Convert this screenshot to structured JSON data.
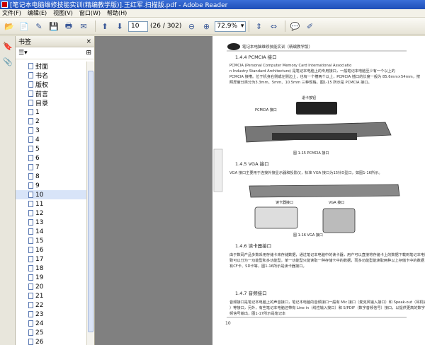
{
  "window": {
    "title": "[笔记本电脑维修技能实训(精编教学版)].王红军.扫描版.pdf - Adobe Reader"
  },
  "menu": {
    "items": [
      "文件(F)",
      "编辑(E)",
      "视图(V)",
      "窗口(W)",
      "帮助(H)"
    ]
  },
  "toolbar": {
    "page_value": "10",
    "page_total": "(26 / 302)",
    "zoom_value": "72.9%"
  },
  "bookmarks": {
    "title": "书签",
    "items": [
      "封面",
      "书名",
      "版权",
      "前言",
      "目录",
      "1",
      "2",
      "3",
      "4",
      "5",
      "6",
      "7",
      "8",
      "9",
      "10",
      "11",
      "12",
      "13",
      "14",
      "15",
      "16",
      "17",
      "18",
      "19",
      "20",
      "21",
      "22",
      "23",
      "24",
      "25",
      "26",
      "27"
    ],
    "selected_index": 14
  },
  "document": {
    "header": "笔记本电脑维修技能实训（精编教学版）",
    "section1_title": "1.4.4  PCMCIA 接口",
    "section1_body": "PCMCIA (Personal Computer Memory Card International Association Industry Standard Architecture) 是笔记本电脑上的专用接口，一般笔记本电脑至少有一个以上的 PCMCIA 接槽。位于机身右侧或左侧边上，也有一个槽两个以上，PCMCIA 插口的长度一般为 85.6mm×54mm，按照厚度分类分为3.3mm、5mm、10.5mm 三种规格。图1-15 所示是 PCMCIA 接口。",
    "fig1_label_top": "退卡按钮",
    "fig1_label_left": "PCMCIA 接口",
    "fig1_caption": "图 1-15   PCMCIA 接口",
    "section2_title": "1.4.5  VGA 接口",
    "section2_body": "VGA 接口主要用于连接外接显示器和投影仪，标准 VGA 接口为15针D型口，如图1-16所示。",
    "fig2_label1": "读卡器接口",
    "fig2_label2": "VGA 接口",
    "fig2_caption": "图 1-16   VGA 接口",
    "section3_title": "1.4.6  读卡器接口",
    "section3_body": "由于数码产品多数采用存储卡来存储数据，通过笔记本电脑中的读卡器，用户可以直接将存储卡上的数据下载到笔记本电脑中，读卡器接口大致可以分为一功能型和多功能型，单一功能型只能读取一种存储卡中的数据，而多功能型能读取两种以上存储卡中的数据，目前常见的存储卡有CF卡、SD卡等，图1-16所示是读卡器接口。",
    "section4_title": "1.4.7  音频接口",
    "section4_body": "音频接口是笔记本电脑上的声音接口，笔记本电脑的音频接口一般有 Mic 接口（麦克风输入接口）和 Speak-out（耳机输出）等接口，另外，有些笔记本电脑还带有 Line in（线性输入接口）和 S/PDIF（数字音频信号）接口，以提供更高的数字音频信号输出，图1-17所示是笔记本",
    "page_number": "10",
    "margin_tab": "第一章 笔记本电脑基础知识"
  },
  "colors": {
    "titlebar": "#245edb",
    "selection": "#d8e4f8",
    "doc_bg": "#808080"
  }
}
